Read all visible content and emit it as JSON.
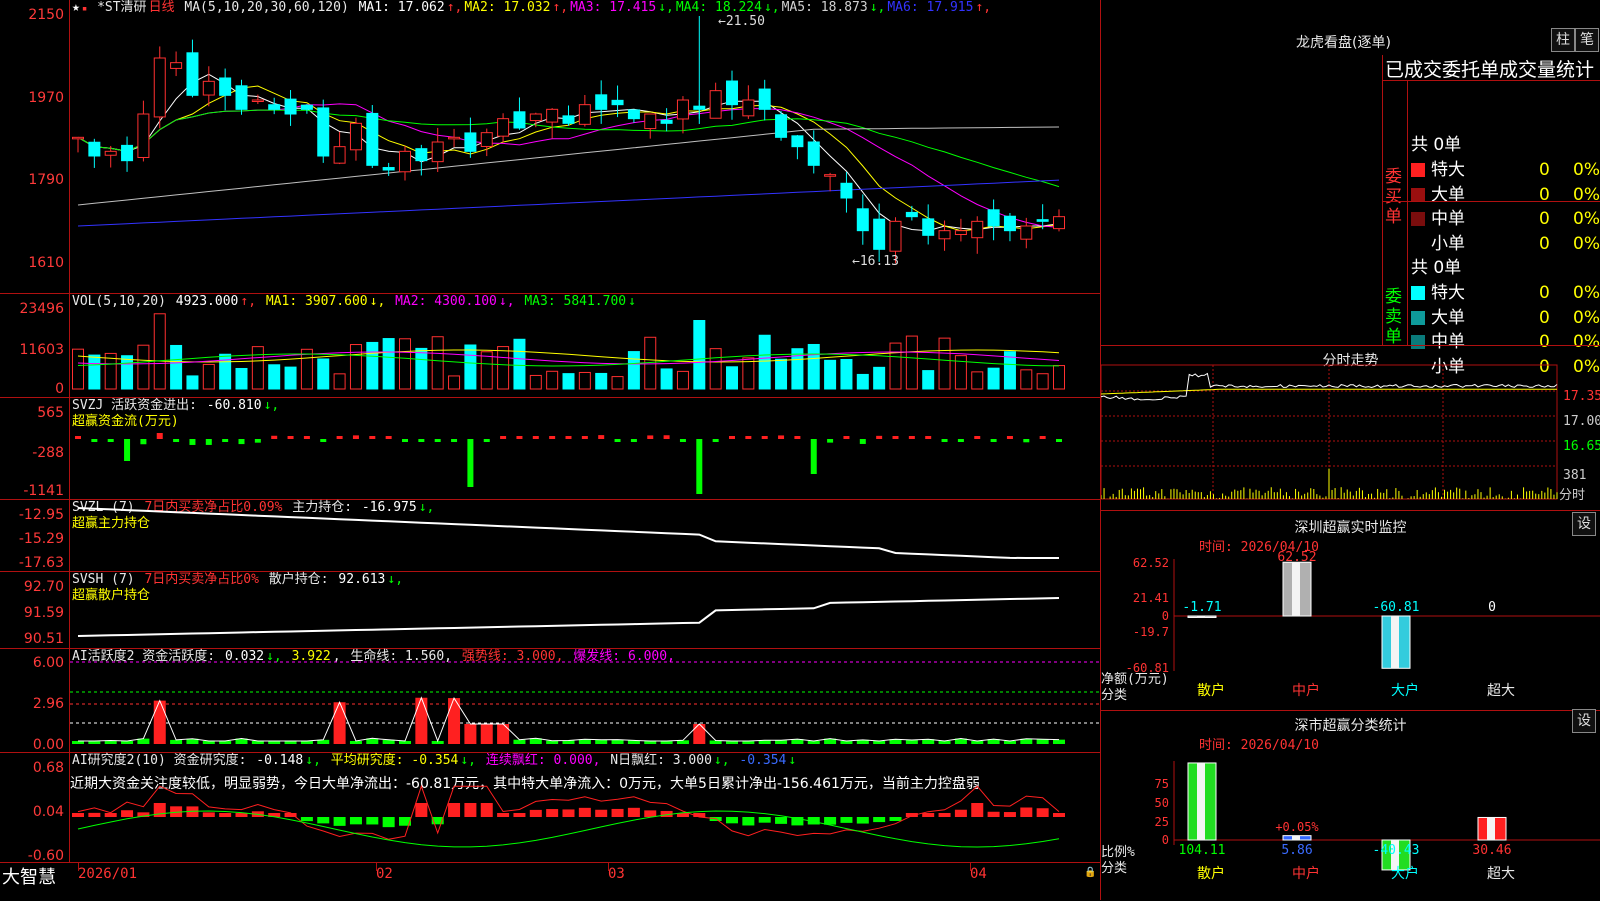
{
  "price_panel": {
    "stock_name": "*ST清研",
    "period": "日线",
    "ma_header": "MA(5,10,20,30,60,120)",
    "ma": [
      {
        "label": "MA1:",
        "value": "17.062",
        "arrow": "↑",
        "color": "#ffffff"
      },
      {
        "label": "MA2:",
        "value": "17.032",
        "arrow": "↑",
        "color": "#ffff00"
      },
      {
        "label": "MA3:",
        "value": "17.415",
        "arrow": "↓",
        "color": "#ff00ff"
      },
      {
        "label": "MA4:",
        "value": "18.224",
        "arrow": "↓",
        "color": "#00ff00"
      },
      {
        "label": "MA5:",
        "value": "18.873",
        "arrow": "↓",
        "color": "#d0d0d0"
      },
      {
        "label": "MA6:",
        "value": "17.915",
        "arrow": "↑",
        "color": "#3333ff"
      }
    ],
    "y_ticks": [
      "2150",
      "1970",
      "1790",
      "1610"
    ],
    "high_label": "21.50",
    "low_label": "16.13"
  },
  "vol_panel": {
    "header": "VOL(5,10,20)",
    "value": "4923.000",
    "ma1": "3907.600",
    "ma2": "4300.100",
    "ma3": "5841.700",
    "y_ticks": [
      "23496",
      "11603",
      "0"
    ]
  },
  "svzj_panel": {
    "header": "SVZJ  活跃资金进出:",
    "value": "-60.810",
    "sub": "超赢资金流(万元)",
    "y_ticks": [
      "565",
      "-288",
      "-1141"
    ]
  },
  "svzl_panel": {
    "header": "SVZL (7)",
    "label": "7日内买卖净占比0.09%",
    "hold": "主力持仓:",
    "hold_value": "-16.975",
    "sub": "超赢主力持仓",
    "y_ticks": [
      "-12.95",
      "-15.29",
      "-17.63"
    ]
  },
  "svsh_panel": {
    "header": "SVSH (7)",
    "label": "7日内买卖净占比0%",
    "hold": "散户持仓:",
    "hold_value": "92.613",
    "sub": "超赢散户持仓",
    "y_ticks": [
      "92.70",
      "91.59",
      "90.51"
    ]
  },
  "ai_active": {
    "header": "AI活跃度2 资金活跃度:",
    "value": "0.032",
    "value2": "3.922",
    "life": "生命线: 1.560,",
    "strong": "强势线: 3.000,",
    "burst": "爆发线: 6.000,",
    "y_ticks": [
      "6.00",
      "2.96",
      "0.00"
    ]
  },
  "ai_research": {
    "header": "AI研究度2(10) 资金研究度:",
    "value": "-0.148",
    "avg": "平均研究度: -0.354",
    "streak": "连续飘红: 0.000,",
    "nday": "N日飘红: 3.000",
    "last": "-0.354",
    "summary": "近期大资金关注度较低，明显弱势，今日大单净流出：-60.81万元，其中特大单净流入：0万元，大单5日累计净出-156.461万元，当前主力控盘弱",
    "y_ticks": [
      "0.68",
      "0.04",
      "-0.60"
    ]
  },
  "x_axis": {
    "labels": [
      "2026/01",
      "02",
      "03",
      "04"
    ]
  },
  "brand": "大智慧",
  "dragon": {
    "title": "龙虎看盘(逐单)",
    "btn1": "柱",
    "btn2": "笔",
    "subtitle": "已成交委托单成交量统计",
    "buy_label": "委买单",
    "sell_label": "委卖单",
    "buy_total": "共 0单",
    "sell_total": "共 0单",
    "rows": [
      {
        "name": "特大",
        "count": "0",
        "pct": "0%"
      },
      {
        "name": "大单",
        "count": "0",
        "pct": "0%"
      },
      {
        "name": "中单",
        "count": "0",
        "pct": "0%"
      },
      {
        "name": "小单",
        "count": "0",
        "pct": "0%"
      }
    ]
  },
  "intraday": {
    "title": "分时走势",
    "price_ticks": [
      "17.35",
      "17.00",
      "16.65"
    ],
    "vol_tick": "381",
    "vol_label": "分时"
  },
  "monitor": {
    "title": "深圳超赢实时监控",
    "btn": "设",
    "time": "时间: 2026/04/10",
    "y_ticks": [
      "62.52",
      "21.41",
      "0",
      "-19.7",
      "-60.81"
    ],
    "ylabel": "净额(万元)",
    "xlabel": "分类",
    "categories": [
      "散户",
      "中户",
      "大户",
      "超大"
    ],
    "values": [
      "-1.71",
      "62.52",
      "-60.81",
      "0"
    ]
  },
  "classify": {
    "title": "深市超赢分类统计",
    "btn": "设",
    "time": "时间: 2026/04/10",
    "y_ticks": [
      "75",
      "50",
      "25",
      "0"
    ],
    "ylabel": "比例%",
    "xlabel": "分类",
    "categories": [
      "散户",
      "中户",
      "大户",
      "超大"
    ],
    "values": [
      "104.11",
      "5.86",
      "-40.43",
      "30.46"
    ],
    "pct_label": "+0.05%"
  },
  "chart_data": {
    "type": "bar",
    "title": "深圳超赢实时监控",
    "categories": [
      "散户",
      "中户",
      "大户",
      "超大"
    ],
    "values": [
      -1.71,
      62.52,
      -60.81,
      0
    ],
    "ylabel": "净额(万元)",
    "ylim": [
      -60.81,
      62.52
    ]
  }
}
